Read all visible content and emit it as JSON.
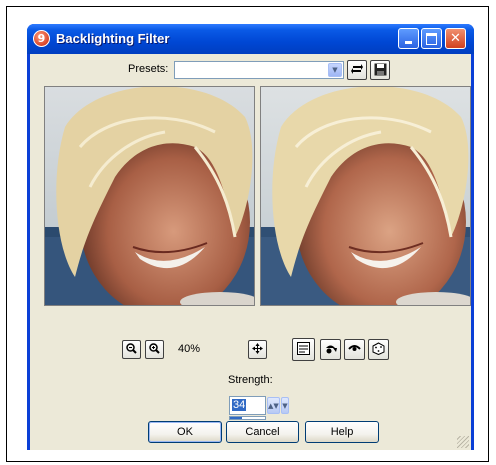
{
  "window": {
    "app_icon": "9",
    "title": "Backlighting Filter",
    "icons": [
      "app-icon",
      "minimize-icon",
      "maximize-icon",
      "close-icon"
    ]
  },
  "presets": {
    "label": "Presets:",
    "value": "",
    "icons": [
      "load-preset-icon",
      "save-preset-icon"
    ]
  },
  "preview": {
    "before_name": "original-preview",
    "after_name": "filtered-preview"
  },
  "zoom": {
    "label": "40%",
    "icons": [
      "zoom-out-icon",
      "zoom-in-icon",
      "navigate-icon"
    ]
  },
  "toolbar": {
    "icons": [
      "proof-icon",
      "reset-icon",
      "randomize-eye-icon",
      "randomize-icon"
    ]
  },
  "strength": {
    "label": "Strength:",
    "value": "34",
    "fraction": 0.34
  },
  "buttons": {
    "ok": "OK",
    "cancel": "Cancel",
    "help": "Help"
  },
  "colors": {
    "titlebar": "#0047d4",
    "dialog_bg": "#ece9d8",
    "selection": "#316ac5"
  }
}
